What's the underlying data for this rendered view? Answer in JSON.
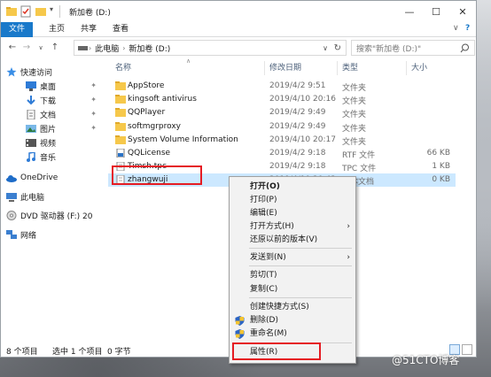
{
  "window": {
    "title": "新加卷 (D:)",
    "controls": {
      "minimize": "—",
      "maximize": "☐",
      "close": "✕"
    }
  },
  "ribbon": {
    "tabs": [
      "文件",
      "主页",
      "共享",
      "查看"
    ],
    "collapse_glyph": "∨",
    "help_glyph": "?"
  },
  "address": {
    "segments": [
      "此电脑",
      "新加卷 (D:)"
    ],
    "dropdown_glyph": "∨",
    "refresh_glyph": "↻"
  },
  "search": {
    "placeholder": "搜索\"新加卷 (D:)\""
  },
  "navpane": {
    "items": [
      {
        "label": "快速访问",
        "icon": "star-icon"
      },
      {
        "label": "桌面",
        "icon": "desktop-icon",
        "pinned": true
      },
      {
        "label": "下载",
        "icon": "download-icon",
        "pinned": true
      },
      {
        "label": "文档",
        "icon": "document-icon",
        "pinned": true
      },
      {
        "label": "图片",
        "icon": "picture-icon",
        "pinned": true
      },
      {
        "label": "视频",
        "icon": "video-icon"
      },
      {
        "label": "音乐",
        "icon": "music-icon"
      },
      {
        "label": "OneDrive",
        "icon": "cloud-icon"
      },
      {
        "label": "此电脑",
        "icon": "computer-icon"
      },
      {
        "label": "DVD 驱动器 (F:) 20",
        "icon": "dvd-icon"
      },
      {
        "label": "网络",
        "icon": "network-icon"
      }
    ]
  },
  "columns": {
    "name": "名称",
    "modified": "修改日期",
    "type": "类型",
    "size": "大小"
  },
  "files": [
    {
      "name": "AppStore",
      "modified": "2019/4/2 9:51",
      "type": "文件夹",
      "size": "",
      "kind": "folder"
    },
    {
      "name": "kingsoft antivirus",
      "modified": "2019/4/10 20:16",
      "type": "文件夹",
      "size": "",
      "kind": "folder"
    },
    {
      "name": "QQPlayer",
      "modified": "2019/4/2 9:49",
      "type": "文件夹",
      "size": "",
      "kind": "folder"
    },
    {
      "name": "softmgrproxy",
      "modified": "2019/4/2 9:49",
      "type": "文件夹",
      "size": "",
      "kind": "folder"
    },
    {
      "name": "System Volume Information",
      "modified": "2019/4/10 20:17",
      "type": "文件夹",
      "size": "",
      "kind": "folder"
    },
    {
      "name": "QQLicense",
      "modified": "2019/4/2 9:18",
      "type": "RTF 文件",
      "size": "66 KB",
      "kind": "rtf"
    },
    {
      "name": "Timsh.tpc",
      "modified": "2019/4/2 9:18",
      "type": "TPC 文件",
      "size": "1 KB",
      "kind": "file"
    },
    {
      "name": "zhangwuji",
      "modified": "2019/4/10 20:42",
      "type": "文本文档",
      "size": "0 KB",
      "kind": "file",
      "selected": true
    }
  ],
  "status": {
    "count": "8 个项目",
    "selected": "选中 1 个项目",
    "selected_size": "0 字节"
  },
  "context_menu": {
    "items": [
      {
        "label": "打开(O)",
        "bold": true
      },
      {
        "label": "打印(P)"
      },
      {
        "label": "编辑(E)"
      },
      {
        "label": "打开方式(H)",
        "submenu": true
      },
      {
        "label": "还原以前的版本(V)"
      },
      {
        "label": "发送到(N)",
        "submenu": true
      },
      {
        "label": "剪切(T)"
      },
      {
        "label": "复制(C)"
      },
      {
        "label": "创建快捷方式(S)"
      },
      {
        "label": "删除(D)",
        "shield": true
      },
      {
        "label": "重命名(M)",
        "shield": true
      },
      {
        "label": "属性(R)"
      }
    ],
    "submenu_glyph": "›"
  },
  "watermark": "@51CTO博客",
  "colors": {
    "accent": "#1979ca",
    "selection": "#cce8ff",
    "highlight": "#e51c23",
    "folder": "#f6c84b"
  }
}
